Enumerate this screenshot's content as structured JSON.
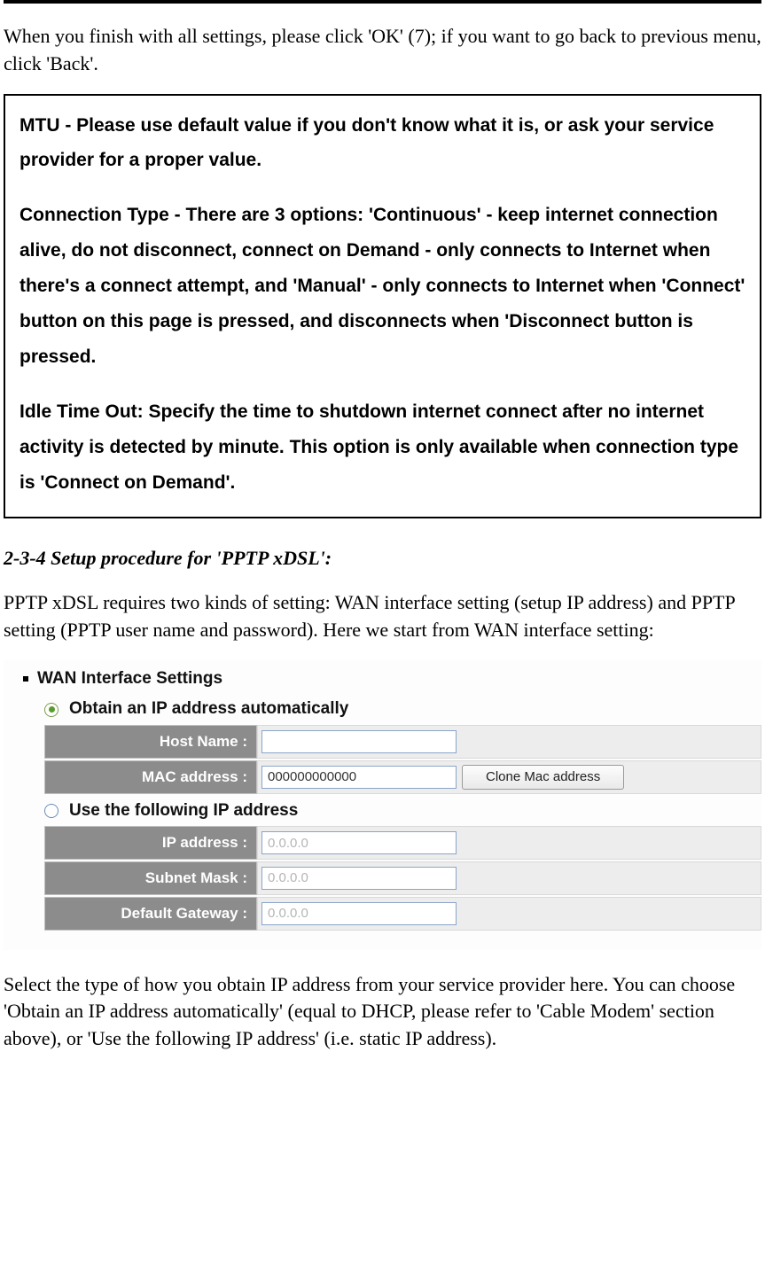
{
  "intro": "When you finish with all settings, please click 'OK' (7); if you want to go back to previous menu, click 'Back'.",
  "noteBox": {
    "mtu": "MTU - Please use default value if you don't know what it is, or ask your service provider for a proper value.",
    "connType": "Connection Type - There are 3 options: 'Continuous' - keep internet connection alive, do not disconnect, connect on Demand - only connects to Internet when there's a connect attempt, and 'Manual' - only connects to Internet when 'Connect' button on this page is pressed, and disconnects when 'Disconnect button is pressed.",
    "idle": "Idle Time Out: Specify the time to shutdown internet connect after no internet activity is detected by minute. This option is only available when connection type is 'Connect on Demand'."
  },
  "sectionHeading": "2-3-4 Setup procedure for 'PPTP xDSL':",
  "pptpIntro": "PPTP xDSL requires two kinds of setting: WAN interface setting (setup IP address) and PPTP setting (PPTP user name and password). Here we start from WAN interface setting:",
  "wan": {
    "title": "WAN Interface Settings",
    "optAuto": "Obtain an IP address automatically",
    "optStatic": "Use the following IP address",
    "hostNameLabel": "Host Name :",
    "hostNameValue": "",
    "macLabel": "MAC address :",
    "macValue": "000000000000",
    "cloneBtn": "Clone Mac address",
    "ipLabel": "IP address :",
    "ipValue": "0.0.0.0",
    "maskLabel": "Subnet Mask :",
    "maskValue": "0.0.0.0",
    "gwLabel": "Default Gateway :",
    "gwValue": "0.0.0.0"
  },
  "outro": "Select the type of how you obtain IP address from your service provider here. You can choose 'Obtain an IP address automatically' (equal to DHCP, please refer to 'Cable Modem' section above), or 'Use the following IP address' (i.e. static IP address)."
}
